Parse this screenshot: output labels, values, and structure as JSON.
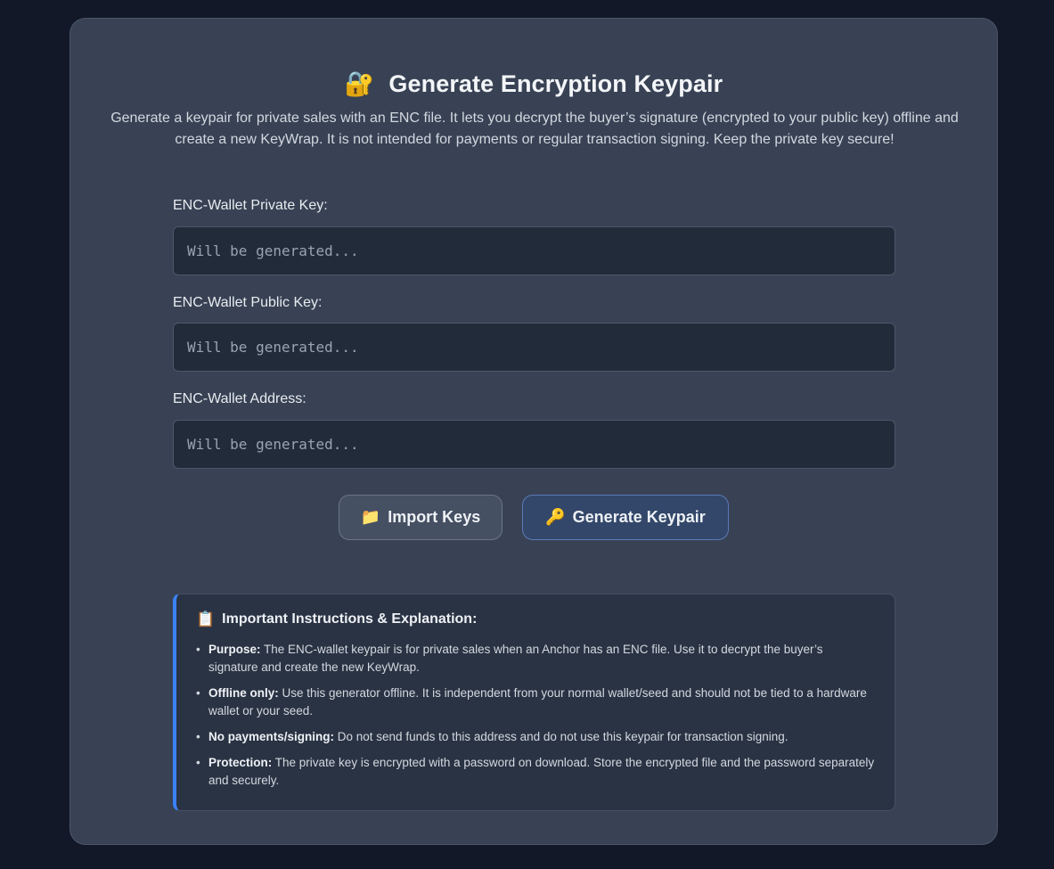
{
  "header": {
    "icon": "lock-with-key-icon",
    "icon_glyph": "🔐",
    "title": "Generate Encryption Keypair",
    "description": "Generate a keypair for private sales with an ENC file. It lets you decrypt the buyer’s signature (encrypted to your public key) offline and create a new KeyWrap. It is not intended for payments or regular transaction signing. Keep the private key secure!"
  },
  "fields": {
    "private_key": {
      "label": "ENC-Wallet Private Key:",
      "value": "",
      "placeholder": "Will be generated..."
    },
    "public_key": {
      "label": "ENC-Wallet Public Key:",
      "value": "",
      "placeholder": "Will be generated..."
    },
    "address": {
      "label": "ENC-Wallet Address:",
      "value": "",
      "placeholder": "Will be generated..."
    }
  },
  "buttons": {
    "import": {
      "icon": "folder-icon",
      "icon_glyph": "📁",
      "label": "Import Keys"
    },
    "generate": {
      "icon": "key-icon",
      "icon_glyph": "🔑",
      "label": "Generate Keypair"
    }
  },
  "instructions": {
    "icon": "clipboard-icon",
    "icon_glyph": "📋",
    "title": "Important Instructions & Explanation:",
    "items": [
      {
        "term": "Purpose:",
        "text": " The ENC-wallet keypair is for private sales when an Anchor has an ENC file. Use it to decrypt the buyer’s signature and create the new KeyWrap."
      },
      {
        "term": "Offline only:",
        "text": " Use this generator offline. It is independent from your normal wallet/seed and should not be tied to a hardware wallet or your seed."
      },
      {
        "term": "No payments/signing:",
        "text": " Do not send funds to this address and do not use this keypair for transaction signing."
      },
      {
        "term": "Protection:",
        "text": " The private key is encrypted with a password on download. Store the encrypted file and the password separately and securely."
      }
    ]
  },
  "colors": {
    "background": "#121828",
    "card": "#384254",
    "input": "#222b3a",
    "accent": "#3b82f6",
    "generate_button": "#33476a"
  }
}
